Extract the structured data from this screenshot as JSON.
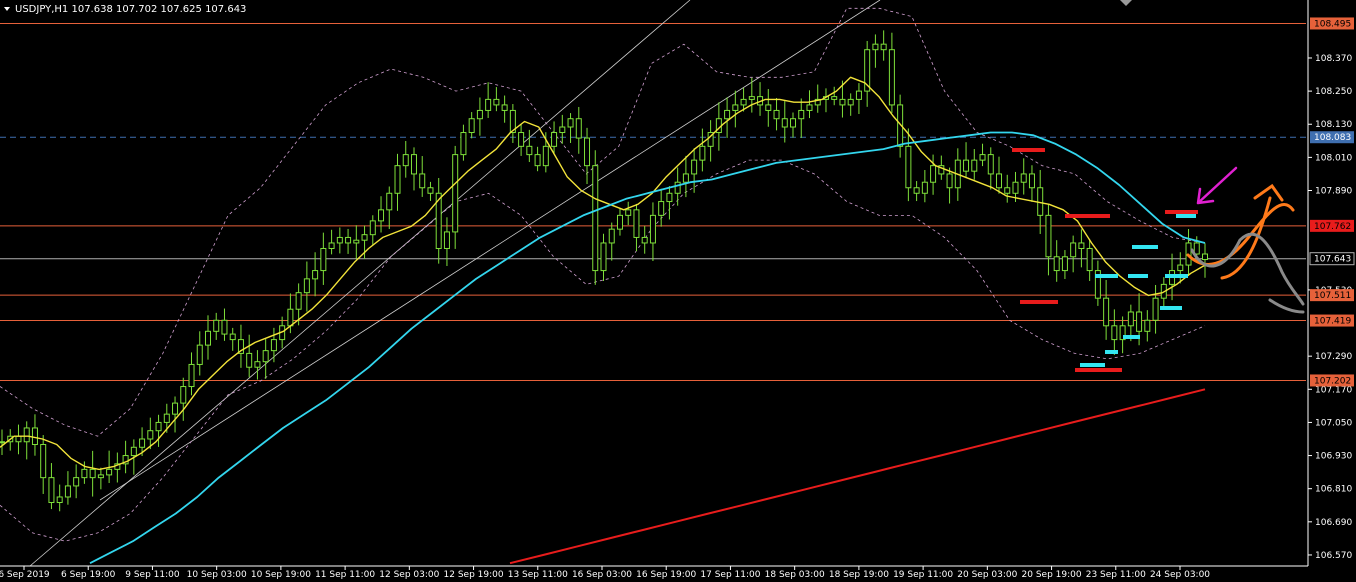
{
  "title": "USDJPY,H1  107.638 107.702 107.625 107.643",
  "colors": {
    "background": "#000000",
    "bull_candle": "#7fe03a",
    "ma_fast": "#f2e33a",
    "ma_mid": "#33d6ee",
    "ma_slow": "#e81c1c",
    "bollinger": "#d0a0d0",
    "level_line": "#e6613a",
    "dashed_level": "#3f6fb0",
    "current_line": "#b0b0b0"
  },
  "chart_data": {
    "type": "line",
    "symbol": "USDJPY",
    "timeframe": "H1",
    "ohlc": {
      "open": 107.638,
      "high": 107.702,
      "low": 107.625,
      "close": 107.643
    },
    "ylim": [
      106.53,
      108.58
    ],
    "x_ticks": [
      "6 Sep 2019",
      "6 Sep 19:00",
      "9 Sep 11:00",
      "10 Sep 03:00",
      "10 Sep 19:00",
      "11 Sep 11:00",
      "12 Sep 03:00",
      "12 Sep 19:00",
      "13 Sep 11:00",
      "16 Sep 03:00",
      "16 Sep 19:00",
      "17 Sep 11:00",
      "18 Sep 03:00",
      "18 Sep 19:00",
      "19 Sep 11:00",
      "20 Sep 03:00",
      "20 Sep 19:00",
      "23 Sep 11:00",
      "24 Sep 03:00"
    ],
    "y_ticks": [
      "108.370",
      "108.250",
      "108.130",
      "108.010",
      "107.890",
      "107.530",
      "107.290",
      "107.170",
      "107.050",
      "106.930",
      "106.810",
      "106.690",
      "106.570"
    ],
    "price_tags": [
      {
        "label": "108.495",
        "value": 108.495,
        "style": "orange"
      },
      {
        "label": "108.083",
        "value": 108.083,
        "style": "blue"
      },
      {
        "label": "107.762",
        "value": 107.762,
        "style": "red"
      },
      {
        "label": "107.643",
        "value": 107.643,
        "style": "gray"
      },
      {
        "label": "107.511",
        "value": 107.511,
        "style": "orange"
      },
      {
        "label": "107.419",
        "value": 107.419,
        "style": "orange"
      },
      {
        "label": "107.202",
        "value": 107.202,
        "style": "orange"
      }
    ],
    "horizontal_levels": [
      108.495,
      107.762,
      107.511,
      107.419,
      107.202
    ],
    "dashed_levels": [
      108.083
    ],
    "current_price": 107.643,
    "series": [
      {
        "key": "close",
        "values": [
          106.98,
          107.0,
          106.98,
          107.03,
          106.97,
          106.85,
          106.76,
          106.78,
          106.82,
          106.85,
          106.88,
          106.85,
          106.86,
          106.88,
          106.9,
          106.93,
          106.96,
          106.99,
          107.02,
          107.05,
          107.08,
          107.12,
          107.18,
          107.26,
          107.33,
          107.38,
          107.42,
          107.37,
          107.35,
          107.3,
          107.25,
          107.27,
          107.31,
          107.35,
          107.4,
          107.46,
          107.52,
          107.57,
          107.6,
          107.68,
          107.7,
          107.72,
          107.7,
          107.71,
          107.73,
          107.78,
          107.82,
          107.88,
          107.98,
          108.02,
          107.95,
          107.9,
          107.88,
          107.68,
          107.74,
          108.02,
          108.1,
          108.15,
          108.18,
          108.22,
          108.2,
          108.18,
          108.1,
          108.05,
          108.02,
          107.98,
          108.05,
          108.1,
          108.12,
          108.15,
          108.08,
          107.98,
          107.6,
          107.7,
          107.75,
          107.8,
          107.82,
          107.72,
          107.7,
          107.8,
          107.85,
          107.88,
          107.92,
          107.95,
          108.0,
          108.05,
          108.1,
          108.15,
          108.18,
          108.2,
          108.22,
          108.23,
          108.2,
          108.18,
          108.15,
          108.12,
          108.15,
          108.18,
          108.2,
          108.22,
          108.23,
          108.22,
          108.2,
          108.22,
          108.25,
          108.4,
          108.42,
          108.4,
          108.2,
          108.05,
          107.9,
          107.88,
          107.92,
          107.98,
          107.95,
          107.9,
          108.0,
          107.96,
          108.0,
          108.02,
          107.95,
          107.9,
          107.88,
          107.92,
          107.95,
          107.9,
          107.8,
          107.65,
          107.6,
          107.65,
          107.7,
          107.68,
          107.6,
          107.5,
          107.4,
          107.35,
          107.4,
          107.45,
          107.38,
          107.42,
          107.5,
          107.55,
          107.6,
          107.62,
          107.7,
          107.66,
          107.64
        ]
      },
      {
        "key": "ma_fast",
        "values": [
          106.96,
          107.0,
          107.0,
          106.99,
          106.97,
          106.92,
          106.89,
          106.88,
          106.89,
          106.91,
          106.94,
          106.98,
          107.04,
          107.1,
          107.17,
          107.22,
          107.27,
          107.31,
          107.34,
          107.36,
          107.38,
          107.42,
          107.46,
          107.51,
          107.57,
          107.63,
          107.68,
          107.72,
          107.74,
          107.76,
          107.8,
          107.86,
          107.91,
          107.96,
          108.0,
          108.04,
          108.1,
          108.14,
          108.12,
          108.03,
          107.94,
          107.89,
          107.86,
          107.84,
          107.82,
          107.84,
          107.88,
          107.94,
          107.99,
          108.04,
          108.08,
          108.13,
          108.17,
          108.2,
          108.22,
          108.22,
          108.21,
          108.21,
          108.22,
          108.25,
          108.3,
          108.28,
          108.23,
          108.16,
          108.1,
          108.03,
          107.98,
          107.96,
          107.94,
          107.92,
          107.9,
          107.87,
          107.86,
          107.85,
          107.84,
          107.82,
          107.78,
          107.7,
          107.63,
          107.58,
          107.54,
          107.51,
          107.52,
          107.55,
          107.59,
          107.62
        ]
      },
      {
        "key": "ma_mid",
        "values": [
          106.54,
          106.58,
          106.62,
          106.67,
          106.72,
          106.78,
          106.85,
          106.91,
          106.97,
          107.03,
          107.08,
          107.13,
          107.19,
          107.25,
          107.32,
          107.39,
          107.45,
          107.51,
          107.57,
          107.62,
          107.67,
          107.72,
          107.76,
          107.8,
          107.83,
          107.86,
          107.88,
          107.9,
          107.92,
          107.93,
          107.95,
          107.97,
          107.99,
          108.0,
          108.01,
          108.02,
          108.03,
          108.04,
          108.06,
          108.07,
          108.08,
          108.09,
          108.1,
          108.1,
          108.09,
          108.06,
          108.02,
          107.97,
          107.91,
          107.84,
          107.77,
          107.72,
          107.7
        ]
      },
      {
        "key": "ma_slow",
        "values": [
          106.54,
          106.57,
          106.6,
          106.63,
          106.66,
          106.69,
          106.72,
          106.75,
          106.78,
          106.81,
          106.84,
          106.87,
          106.9,
          106.93,
          106.96,
          106.99,
          107.02,
          107.05,
          107.08,
          107.11,
          107.14,
          107.17
        ]
      },
      {
        "key": "bb_upper",
        "values": [
          107.18,
          107.1,
          107.04,
          107.0,
          107.1,
          107.3,
          107.55,
          107.8,
          107.9,
          108.05,
          108.2,
          108.28,
          108.33,
          108.3,
          108.25,
          108.28,
          108.25,
          108.1,
          107.95,
          108.05,
          108.35,
          108.42,
          108.32,
          108.3,
          108.3,
          108.32,
          108.55,
          108.55,
          108.52,
          108.25,
          108.1,
          108.05,
          107.98,
          107.95,
          107.85,
          107.78,
          107.72,
          107.7
        ]
      },
      {
        "key": "bb_lower",
        "values": [
          106.75,
          106.65,
          106.62,
          106.65,
          106.72,
          106.85,
          107.0,
          107.15,
          107.2,
          107.28,
          107.38,
          107.5,
          107.65,
          107.75,
          107.85,
          107.88,
          107.8,
          107.65,
          107.55,
          107.58,
          107.75,
          107.88,
          107.95,
          108.0,
          108.0,
          107.95,
          107.85,
          107.8,
          107.8,
          107.72,
          107.6,
          107.42,
          107.35,
          107.3,
          107.28,
          107.3,
          107.35,
          107.4
        ]
      }
    ],
    "annotations": [
      "magenta-arrow",
      "orange-up-curve",
      "gray-down-curve",
      "red-dashes",
      "cyan-dashes",
      "trendlines"
    ],
    "grid": false,
    "legend": "none"
  }
}
